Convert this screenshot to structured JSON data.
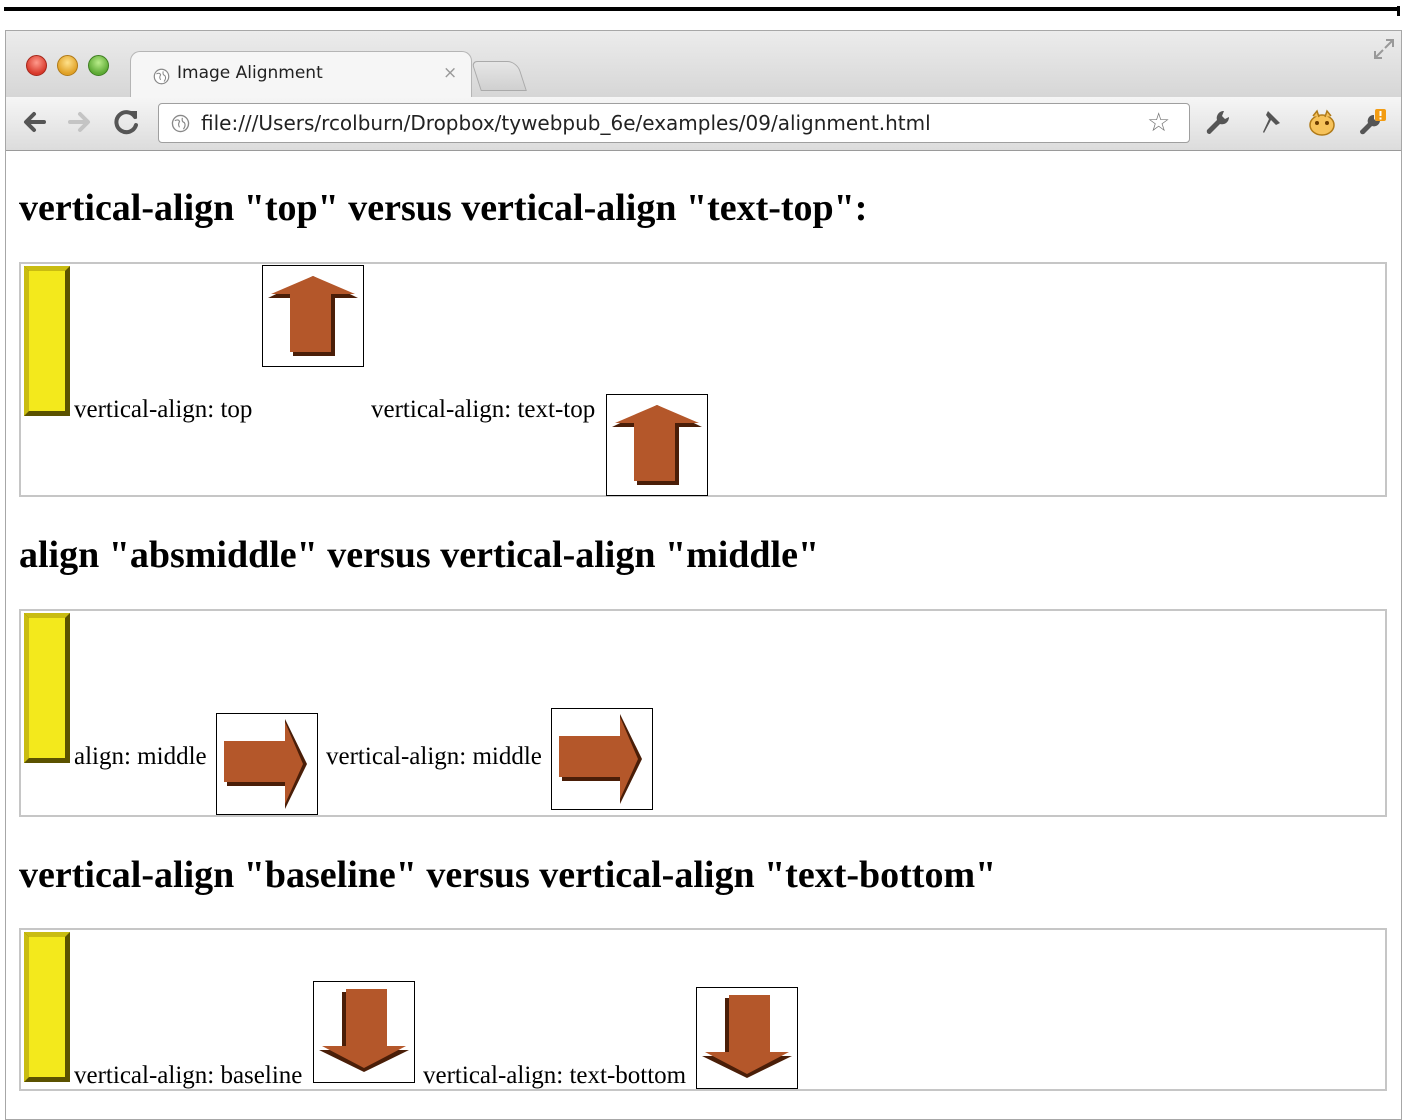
{
  "browser": {
    "tab_title": "Image Alignment",
    "tab_close_glyph": "×",
    "url": "file:///Users/rcolburn/Dropbox/tywebpub_6e/examples/09/alignment.html",
    "star_glyph": "☆",
    "icons": [
      "back-arrow-icon",
      "forward-arrow-icon",
      "reload-icon",
      "globe-icon",
      "bookmark-star-icon",
      "wrench-icon",
      "pin-icon",
      "extension-icon",
      "wrench-alert-icon",
      "fullscreen-icon"
    ]
  },
  "page": {
    "heading1": "vertical-align \"top\" versus vertical-align \"text-top\":",
    "section1": {
      "label1": "vertical-align: top",
      "label2": "vertical-align: text-top"
    },
    "heading2": "align \"absmiddle\" versus vertical-align \"middle\"",
    "section2": {
      "label1": "align: middle",
      "label2": "vertical-align: middle"
    },
    "heading3": "vertical-align \"baseline\" versus vertical-align \"text-bottom\"",
    "section3": {
      "label1": "vertical-align: baseline",
      "label2": "vertical-align: text-bottom"
    }
  },
  "colors": {
    "arrow_fill": "#b4572a",
    "arrow_shadow": "#4a1e08",
    "bar_fill": "#f3e91c",
    "bar_edge": "#5b5200",
    "demo_border": "#c6c6c6"
  }
}
